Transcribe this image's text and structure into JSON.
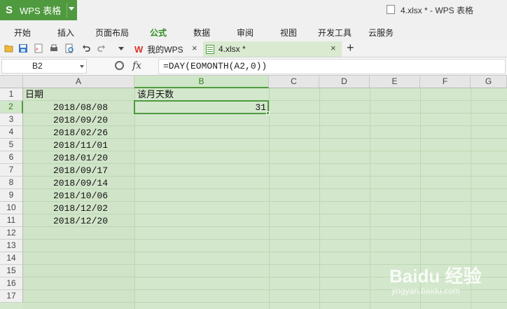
{
  "app": {
    "logo": "S",
    "name": "WPS 表格"
  },
  "window_title": "4.xlsx * - WPS 表格",
  "menu": [
    {
      "label": "开始",
      "active": false
    },
    {
      "label": "插入",
      "active": false
    },
    {
      "label": "页面布局",
      "active": false
    },
    {
      "label": "公式",
      "active": true
    },
    {
      "label": "数据",
      "active": false
    },
    {
      "label": "审阅",
      "active": false
    },
    {
      "label": "视图",
      "active": false
    },
    {
      "label": "开发工具",
      "active": false
    },
    {
      "label": "云服务",
      "active": false
    }
  ],
  "toolbar_icons": [
    "open-folder-icon",
    "save-icon",
    "pdf-export-icon",
    "print-icon",
    "print-preview-icon",
    "undo-icon",
    "redo-icon",
    "more-dropdown-icon"
  ],
  "tabs": [
    {
      "label": "我的WPS",
      "icon": "wps-logo-icon",
      "active": false
    },
    {
      "label": "4.xlsx *",
      "icon": "spreadsheet-icon",
      "active": true
    }
  ],
  "new_tab_symbol": "+",
  "close_symbol": "×",
  "name_box": "B2",
  "fx_symbol": "fx",
  "formula": "=DAY(EOMONTH(A2,0))",
  "columns": [
    "A",
    "B",
    "C",
    "D",
    "E",
    "F",
    "G"
  ],
  "selected_column": "B",
  "rows": [
    "1",
    "2",
    "3",
    "4",
    "5",
    "6",
    "7",
    "8",
    "9",
    "10",
    "11",
    "12",
    "13",
    "14",
    "15",
    "16",
    "17"
  ],
  "selected_row": "2",
  "cells": {
    "A1": "日期",
    "B1": "该月天数",
    "B2": "31",
    "A_dates": [
      "2018/08/08",
      "2018/09/20",
      "2018/02/26",
      "2018/11/01",
      "2018/01/20",
      "2018/09/17",
      "2018/09/14",
      "2018/10/06",
      "2018/12/02",
      "2018/12/20"
    ]
  },
  "colors": {
    "accent": "#4f9a3f",
    "grid_bg": "#d3e7cc",
    "active_menu": "#2e8b1f"
  },
  "watermark": {
    "text": "Baidu 经验",
    "sub": "jingyan.baidu.com"
  }
}
